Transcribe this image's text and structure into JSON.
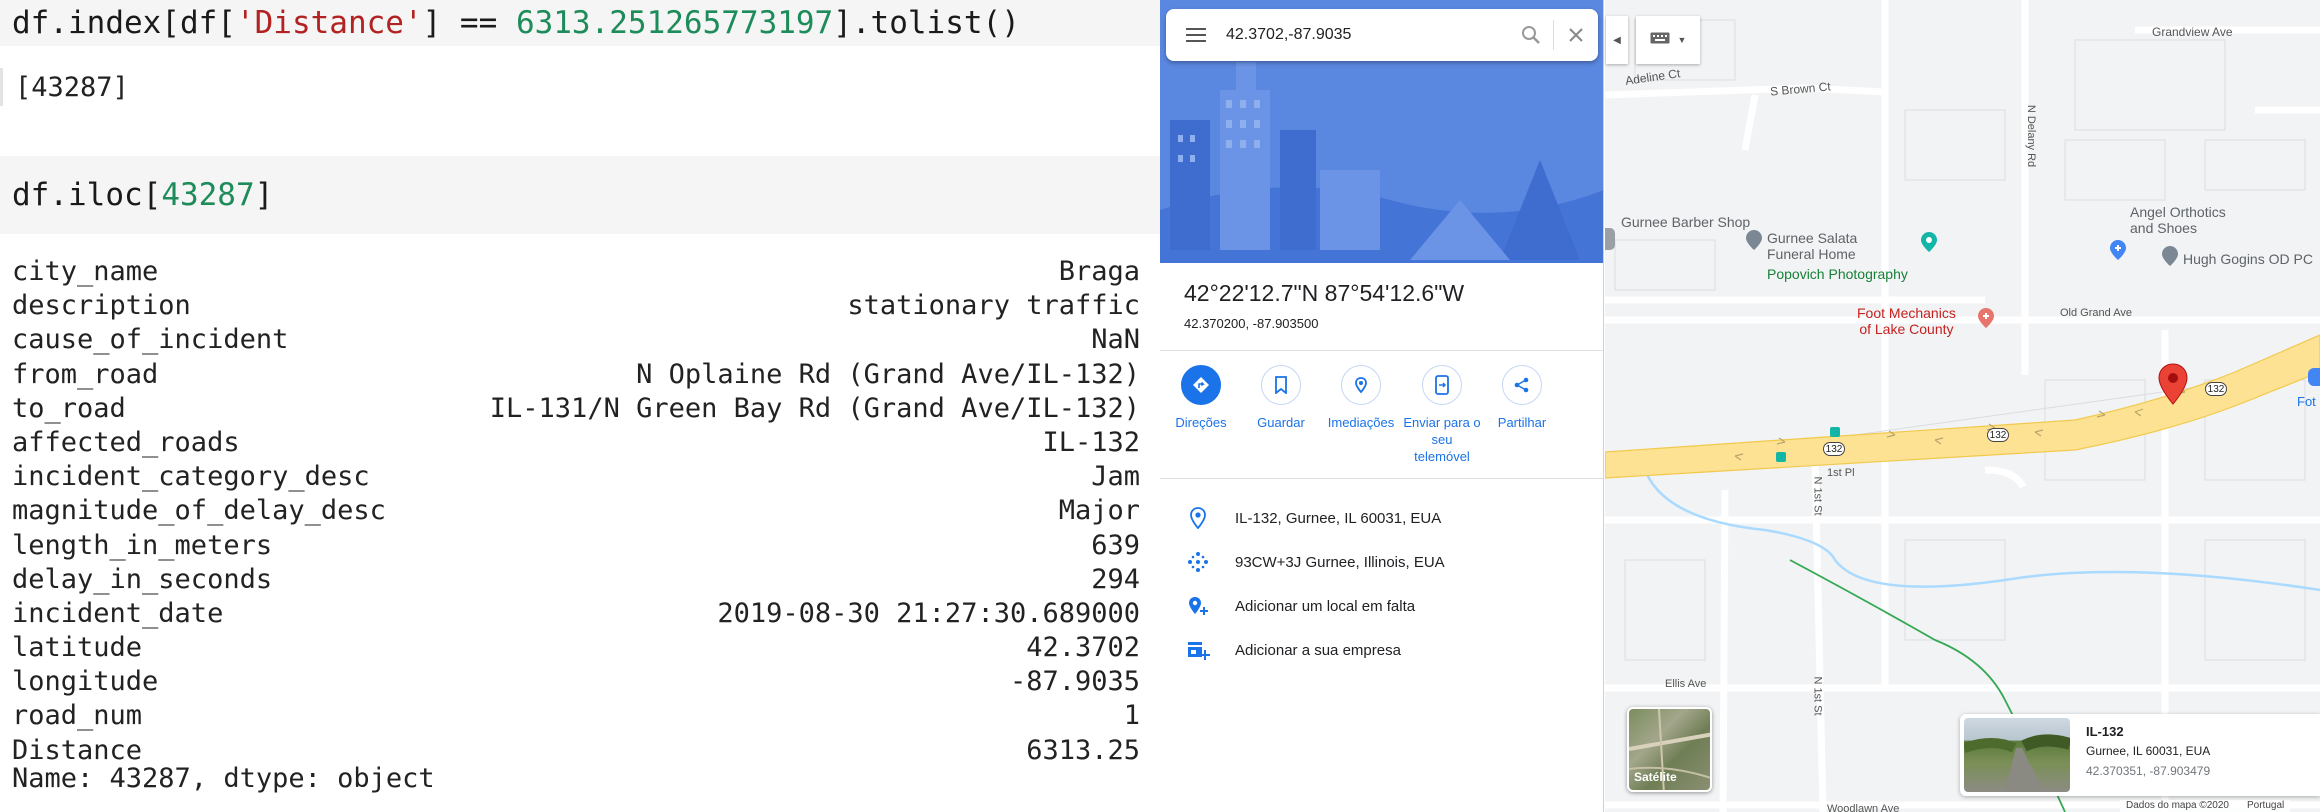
{
  "notebook": {
    "cell1": {
      "prefix": "df.index[df[",
      "str": "'Distance'",
      "mid": "] == ",
      "num": "6313.251265773197",
      "suffix": "].tolist()"
    },
    "out1": "[43287]",
    "cell2": {
      "prefix": "df.iloc[",
      "num": "43287",
      "suffix": "]"
    },
    "series": [
      {
        "key": "city_name",
        "value": "Braga"
      },
      {
        "key": "description",
        "value": "stationary traffic"
      },
      {
        "key": "cause_of_incident",
        "value": "NaN"
      },
      {
        "key": "from_road",
        "value": "N Oplaine Rd (Grand Ave/IL-132)"
      },
      {
        "key": "to_road",
        "value": "IL-131/N Green Bay Rd (Grand Ave/IL-132)"
      },
      {
        "key": "affected_roads",
        "value": "IL-132"
      },
      {
        "key": "incident_category_desc",
        "value": "Jam"
      },
      {
        "key": "magnitude_of_delay_desc",
        "value": "Major"
      },
      {
        "key": "length_in_meters",
        "value": "639"
      },
      {
        "key": "delay_in_seconds",
        "value": "294"
      },
      {
        "key": "incident_date",
        "value": "2019-08-30 21:27:30.689000"
      },
      {
        "key": "latitude",
        "value": "42.3702"
      },
      {
        "key": "longitude",
        "value": "-87.9035"
      },
      {
        "key": "road_num",
        "value": "1"
      },
      {
        "key": "Distance",
        "value": "6313.25"
      }
    ],
    "series_footer": "Name: 43287, dtype: object"
  },
  "maps": {
    "search_value": "42.3702,-87.9035",
    "place_title": "42°22'12.7\"N 87°54'12.6\"W",
    "place_coords": "42.370200, -87.903500",
    "actions": [
      {
        "label": "Direções",
        "icon": "directions-icon"
      },
      {
        "label": "Guardar",
        "icon": "bookmark-icon"
      },
      {
        "label": "Imediações",
        "icon": "nearby-icon"
      },
      {
        "label": "Enviar para o seu telemóvel",
        "icon": "send-to-phone-icon"
      },
      {
        "label": "Partilhar",
        "icon": "share-icon"
      }
    ],
    "info": [
      {
        "text": "IL-132, Gurnee, IL 60031, EUA",
        "icon": "location-pin-icon"
      },
      {
        "text": "93CW+3J Gurnee, Illinois, EUA",
        "icon": "plus-code-icon"
      },
      {
        "text": "Adicionar um local em falta",
        "icon": "add-place-icon"
      },
      {
        "text": "Adicionar a sua empresa",
        "icon": "add-business-icon"
      }
    ]
  },
  "map": {
    "labels": {
      "grandview": "Grandview Ave",
      "adeline": "Adeline Ct",
      "s_brown": "S Brown Ct",
      "n_delany": "N Delany Rd",
      "barber": "Gurnee Barber Shop",
      "salata_1": "Gurnee Salata",
      "salata_2": "Funeral Home",
      "popovich": "Popovich Photography",
      "angel_1": "Angel Orthotics",
      "angel_2": "and Shoes",
      "hugh": "Hugh Gogins OD PC",
      "foot_1": "Foot Mechanics",
      "foot_2": "of Lake County",
      "old_grand": "Old Grand Ave",
      "first_pl": "1st Pl",
      "n_1st_st": "N 1st St",
      "ellis": "Ellis Ave",
      "woodlawn": "Woodlawn Ave",
      "fot": "Fot",
      "shield": "132"
    },
    "satellite_label": "Satélite",
    "card": {
      "title": "IL-132",
      "address": "Gurnee, IL 60031, EUA",
      "coords": "42.370351, -87.903479"
    },
    "footer": {
      "data": "Dados do mapa ©2020",
      "lang": "Portugal"
    },
    "colors": {
      "road": "#fde293",
      "road_edge": "#f2c94c",
      "water": "#aadaff",
      "park": "#34a853",
      "accent": "#1a73e8",
      "pin": "#ea4335"
    }
  }
}
